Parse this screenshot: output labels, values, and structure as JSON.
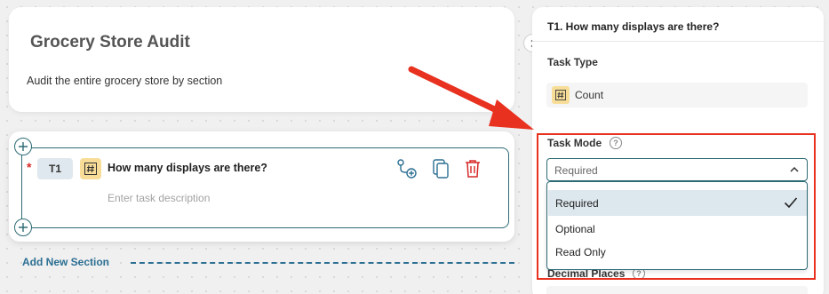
{
  "audit": {
    "title": "Grocery Store Audit",
    "description": "Audit the entire grocery store by section"
  },
  "task": {
    "id": "T1",
    "type_icon": "hash-icon",
    "title": "How many displays are there?",
    "description_placeholder": "Enter task description",
    "required_marker": "*"
  },
  "add_section_label": "Add New Section",
  "panel": {
    "title": "T1. How many displays are there?",
    "task_type_label": "Task Type",
    "task_type_value": "Count",
    "task_mode_label": "Task Mode",
    "task_mode_selected": "Required",
    "task_mode_options": [
      {
        "label": "Required",
        "selected": true
      },
      {
        "label": "Optional",
        "selected": false
      },
      {
        "label": "Read Only",
        "selected": false
      }
    ],
    "decimal_places_label": "Decimal Places"
  },
  "colors": {
    "accent": "#2d6b74",
    "link": "#2c6f93",
    "highlight": "#e8311f",
    "badge": "#f7dd98",
    "required": "#d62828"
  },
  "icons": [
    "plus-icon",
    "hash-icon",
    "branch-add-icon",
    "copy-icon",
    "trash-icon",
    "chevron-right-icon",
    "help-icon",
    "chevron-up-icon",
    "check-icon",
    "arrow-icon"
  ]
}
